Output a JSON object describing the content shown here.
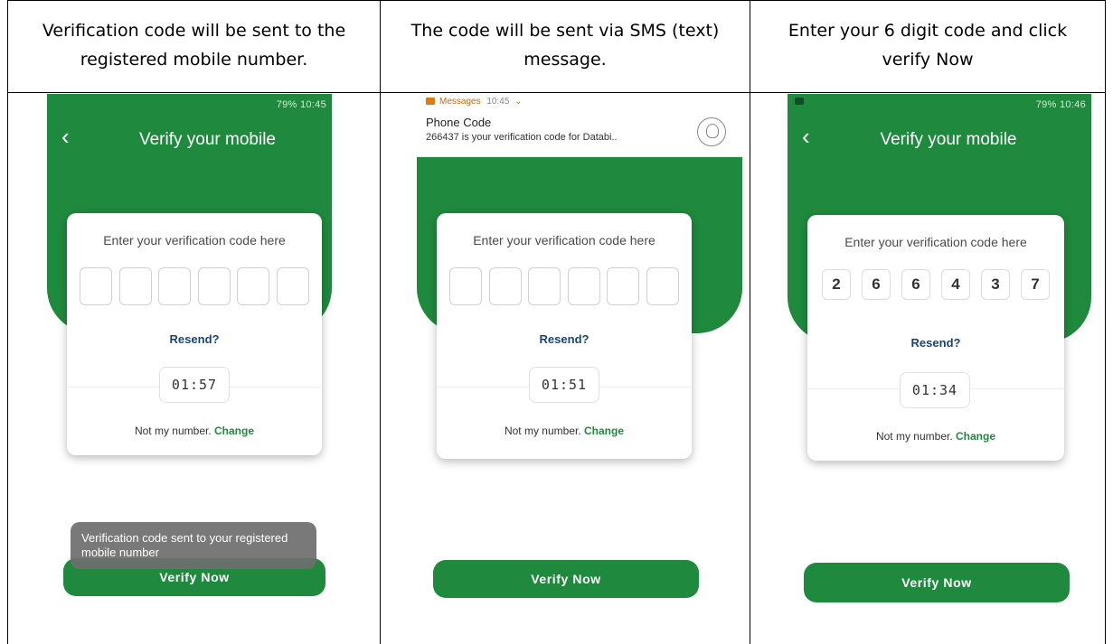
{
  "headers": [
    "Verification code will be sent to the registered mobile number.",
    "The code will be sent via SMS (text) message.",
    "Enter your 6 digit code and click verify Now"
  ],
  "app": {
    "title": "Verify your mobile",
    "prompt": "Enter your verification code here",
    "resend": "Resend?",
    "not_my_number": "Not my number.",
    "change": "Change",
    "verify_button": "Verify Now"
  },
  "screens": [
    {
      "status": "79% 10:45",
      "timer": "01:57",
      "code": [
        "",
        "",
        "",
        "",
        "",
        ""
      ],
      "toast": "Verification code sent to your registered mobile number"
    },
    {
      "timer": "01:51",
      "code": [
        "",
        "",
        "",
        "",
        "",
        ""
      ],
      "notification": {
        "app": "Messages",
        "time": "10:45",
        "title": "Phone Code",
        "body": "266437 is your verification code for Databi.."
      }
    },
    {
      "status": "79% 10:46",
      "timer": "01:34",
      "code": [
        "2",
        "6",
        "6",
        "4",
        "3",
        "7"
      ]
    }
  ],
  "colors": {
    "brand_green": "#1f8a3d",
    "resend_blue": "#17457a",
    "toast_gray": "#6e6e6e"
  },
  "icons": [
    "back-arrow-icon",
    "message-icon",
    "avatar-icon"
  ]
}
